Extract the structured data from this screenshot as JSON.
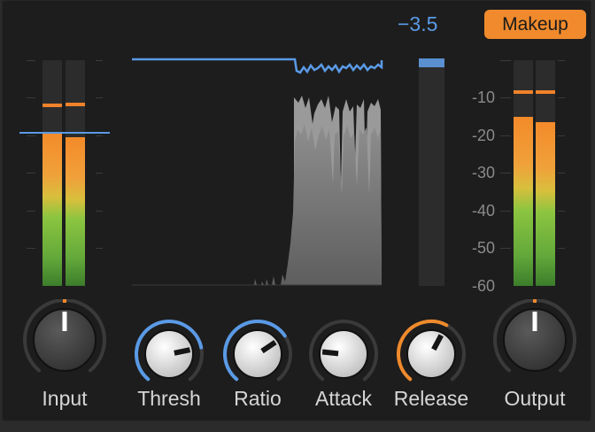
{
  "gain_reduction_readout": "−3.5",
  "makeup_button": {
    "label": "Makeup"
  },
  "output_scale": {
    "labels": [
      "-10",
      "-20",
      "-30",
      "-40",
      "-50",
      "-60"
    ]
  },
  "input_meter": {
    "left_level_db": -19,
    "right_level_db": -20.5,
    "left_peak_db": -12,
    "right_peak_db": -11.8,
    "threshold_db": -19
  },
  "output_meter": {
    "left_level_db": -15,
    "right_level_db": -16.5,
    "left_peak_db": -8.5,
    "right_peak_db": -8.5
  },
  "gr_meter": {
    "level_db": -1.5
  },
  "knobs": [
    {
      "id": "input",
      "label": "Input",
      "value": 0.5,
      "arc": "none",
      "style": "dark"
    },
    {
      "id": "thresh",
      "label": "Thresh",
      "value": 0.78,
      "arc": "blue",
      "style": "light"
    },
    {
      "id": "ratio",
      "label": "Ratio",
      "value": 0.7,
      "arc": "blue",
      "style": "light"
    },
    {
      "id": "attack",
      "label": "Attack",
      "value": 0.2,
      "arc": "none",
      "style": "light"
    },
    {
      "id": "release",
      "label": "Release",
      "value": 0.6,
      "arc": "orange",
      "style": "light"
    },
    {
      "id": "output",
      "label": "Output",
      "value": 0.5,
      "arc": "none",
      "style": "dark"
    }
  ],
  "colors": {
    "accent_orange": "#f08a2c",
    "accent_blue": "#5a9ae6",
    "background": "#1d1d1d"
  }
}
